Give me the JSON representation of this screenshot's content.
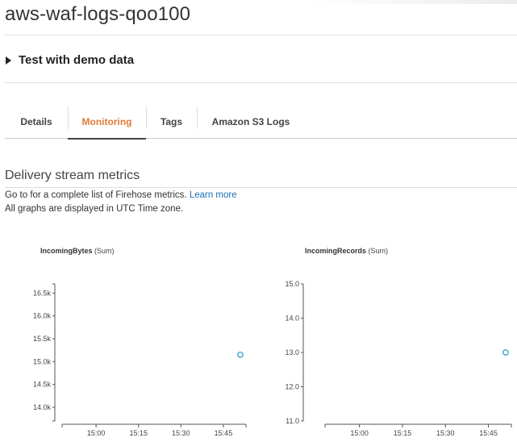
{
  "header": {
    "title": "aws-waf-logs-qoo100"
  },
  "demo": {
    "label": "Test with demo data"
  },
  "tabs": [
    {
      "label": "Details",
      "active": false
    },
    {
      "label": "Monitoring",
      "active": true
    },
    {
      "label": "Tags",
      "active": false
    },
    {
      "label": "Amazon S3 Logs",
      "active": false
    }
  ],
  "metrics": {
    "title": "Delivery stream metrics",
    "desc_prefix": "Go to for a complete list of Firehose metrics.",
    "learn_more": "Learn more",
    "timezone_note": "All graphs are displayed in UTC Time zone."
  },
  "colors": {
    "accent": "#e07b39",
    "link": "#1b6fb8",
    "point": "#2aa3c9"
  },
  "chart_data": [
    {
      "type": "scatter",
      "title_metric": "IncomingBytes",
      "title_stat": "(Sum)",
      "x_ticks": [
        "15:00",
        "15:15",
        "15:30",
        "15:45"
      ],
      "y_ticks": [
        "16.5k",
        "16.0k",
        "15.5k",
        "15.0k",
        "14.5k",
        "14.0k"
      ],
      "ylim": [
        13700,
        16700
      ],
      "points": [
        {
          "x": "15:51",
          "y": 15150
        }
      ]
    },
    {
      "type": "scatter",
      "title_metric": "IncomingRecords",
      "title_stat": "(Sum)",
      "x_ticks": [
        "15:00",
        "15:15",
        "15:30",
        "15:45"
      ],
      "y_ticks": [
        "15.0",
        "14.0",
        "13.0",
        "12.0",
        "11.0"
      ],
      "ylim": [
        11,
        15
      ],
      "points": [
        {
          "x": "15:51",
          "y": 13.0
        }
      ]
    }
  ]
}
